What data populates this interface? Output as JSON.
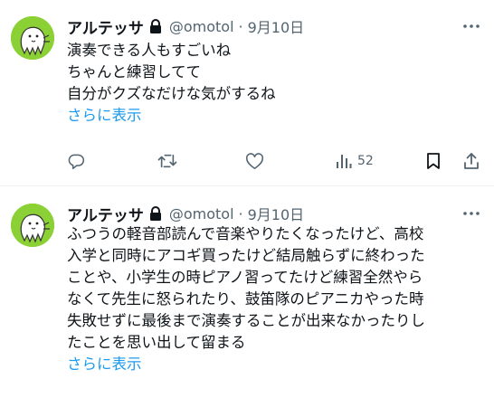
{
  "tweets": [
    {
      "display_name": "アルテッサ",
      "handle": "@omotol",
      "separator": "·",
      "date": "9月10日",
      "lines": [
        "演奏できる人もすごいね",
        "ちゃんと練習してて",
        "自分がクズなだけな気がするね"
      ],
      "show_more": "さらに表示",
      "views": "52"
    },
    {
      "display_name": "アルテッサ",
      "handle": "@omotol",
      "separator": "·",
      "date": "9月10日",
      "lines": [
        "ふつうの軽音部読んで音楽やりたくなったけど、高校",
        "入学と同時にアコギ買ったけど結局触らずに終わった",
        "ことや、小学生の時ピアノ習ってたけど練習全然やら",
        "なくて先生に怒られたり、鼓笛隊のピアニカやった時",
        "失敗せずに最後まで演奏することが出来なかったりし",
        "たことを思い出して留まる"
      ],
      "show_more": "さらに表示"
    }
  ],
  "icons": {
    "lock": "lock-icon",
    "more": "more-icon",
    "reply": "reply-icon",
    "retweet": "retweet-icon",
    "like": "like-icon",
    "views": "views-icon",
    "bookmark": "bookmark-icon",
    "share": "share-icon"
  },
  "colors": {
    "link": "#1d9bf0",
    "muted": "#536471",
    "avatar_bg": "#8bd135"
  }
}
